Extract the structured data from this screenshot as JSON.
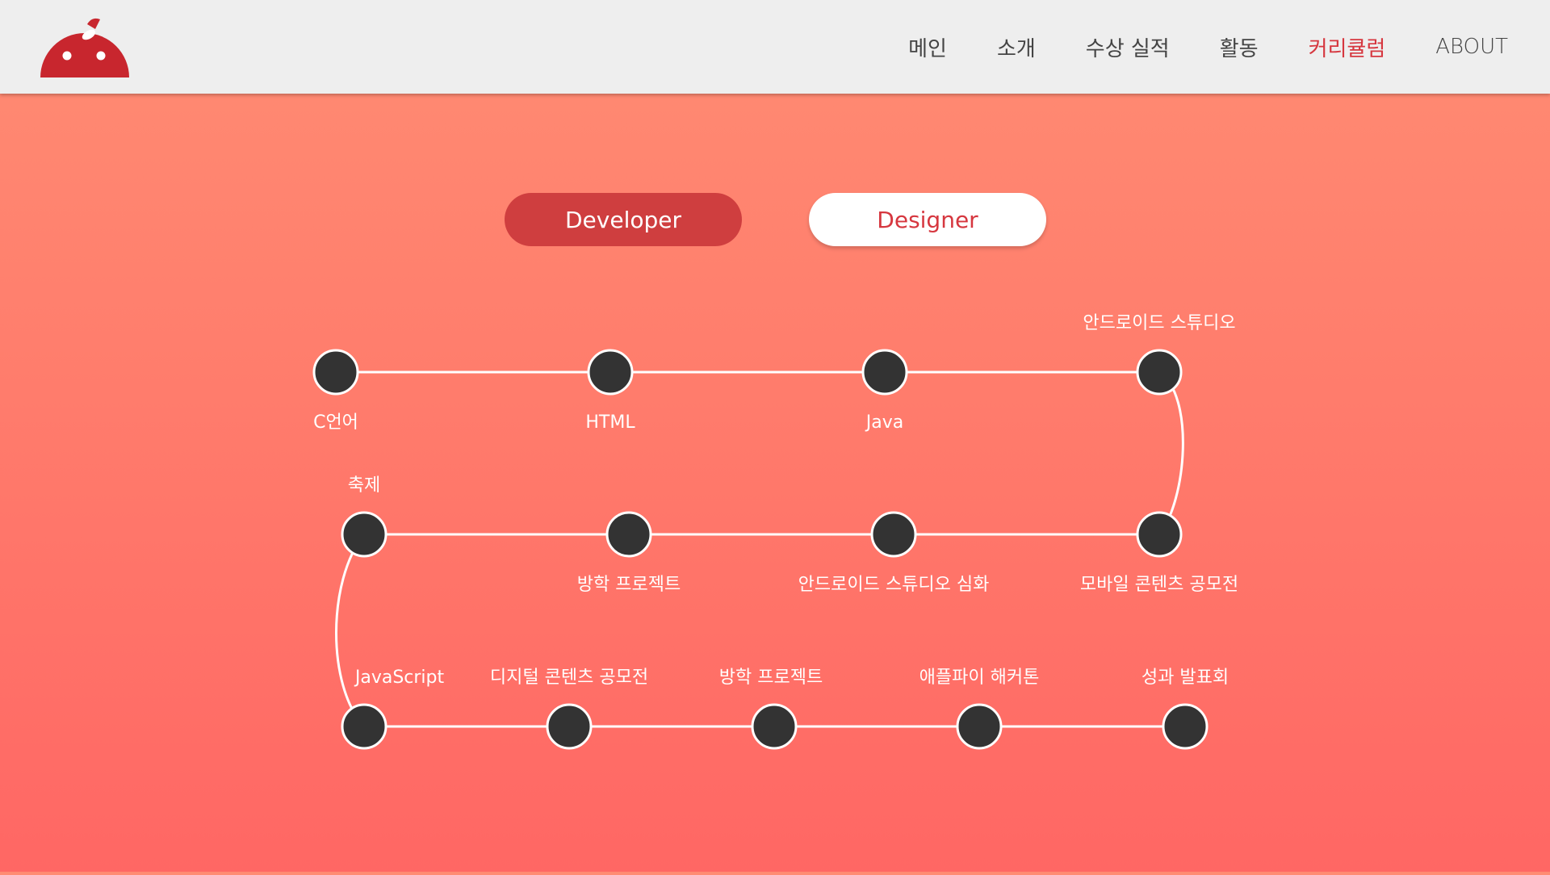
{
  "nav": {
    "logo": "app-logo",
    "items": [
      {
        "label": "메인"
      },
      {
        "label": "소개"
      },
      {
        "label": "수상 실적"
      },
      {
        "label": "활동"
      },
      {
        "label": "커리큘럼"
      },
      {
        "label": "ABOUT"
      }
    ],
    "active_index": 4
  },
  "tabs": {
    "developer": "Developer",
    "designer": "Designer",
    "selected": "developer"
  },
  "timeline": {
    "row1": [
      "C언어",
      "HTML",
      "Java",
      "안드로이드 스튜디오"
    ],
    "row2": [
      "축제",
      "방학 프로젝트",
      "안드로이드 스튜디오 심화",
      "모바일 콘텐츠 공모전"
    ],
    "row3": [
      "JavaScript",
      "디지털 콘텐츠 공모전",
      "방학 프로젝트",
      "애플파이 해커톤",
      "성과 발표회"
    ]
  },
  "colors": {
    "accent": "#d6373f",
    "node": "#333333",
    "line": "#ffffff"
  }
}
